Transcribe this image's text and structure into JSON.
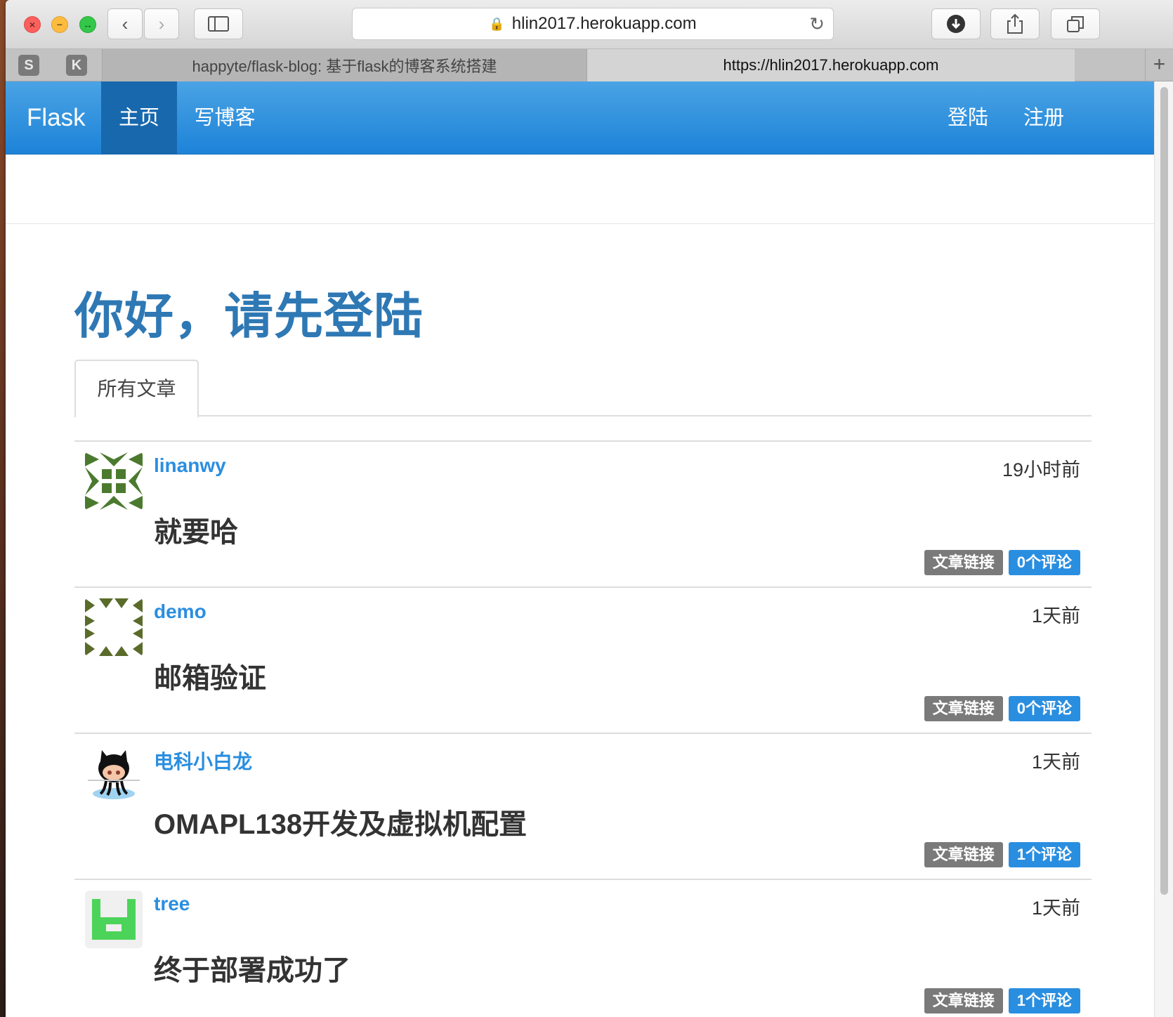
{
  "browser": {
    "url": "hlin2017.herokuapp.com",
    "pinned_tabs": [
      "S",
      "K"
    ],
    "tabs": [
      {
        "title": "happyte/flask-blog: 基于flask的博客系统搭建"
      },
      {
        "title": "https://hlin2017.herokuapp.com"
      }
    ],
    "new_tab_label": "+"
  },
  "navbar": {
    "brand": "Flask",
    "home": "主页",
    "write": "写博客",
    "login": "登陆",
    "register": "注册",
    "color": "#2388da",
    "active_color": "#1868ad"
  },
  "main": {
    "headline": "你好，请先登陆",
    "tab_all_posts": "所有文章"
  },
  "posts": [
    {
      "author": "linanwy",
      "time": "19小时前",
      "title": "就要哈",
      "link_label": "文章链接",
      "comments_label": "0个评论"
    },
    {
      "author": "demo",
      "time": "1天前",
      "title": "邮箱验证",
      "link_label": "文章链接",
      "comments_label": "0个评论"
    },
    {
      "author": "电科小白龙",
      "time": "1天前",
      "title": "OMAPL138开发及虚拟机配置",
      "link_label": "文章链接",
      "comments_label": "1个评论"
    },
    {
      "author": "tree",
      "time": "1天前",
      "title": "终于部署成功了",
      "link_label": "文章链接",
      "comments_label": "1个评论"
    }
  ]
}
